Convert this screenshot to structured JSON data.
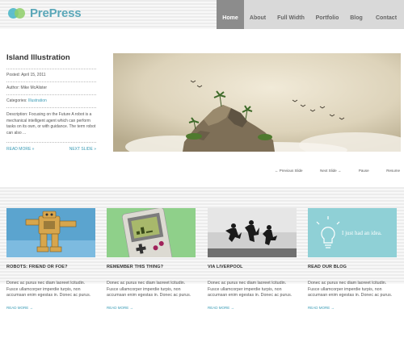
{
  "brand": {
    "name": "PrePress"
  },
  "nav": [
    {
      "label": "Home",
      "active": true
    },
    {
      "label": "About"
    },
    {
      "label": "Full Width"
    },
    {
      "label": "Portfolio"
    },
    {
      "label": "Blog"
    },
    {
      "label": "Contact"
    }
  ],
  "feature": {
    "title": "Island Illustration",
    "posted": "Posted: April 15, 2011",
    "author": "Author: Mike McAlister",
    "categories_label": "Categories:",
    "category": "Illustration",
    "description": "Description: Focusing on the Future A robot is a mechanical intelligent agent which can perform tasks on its own, or with guidance. The term robot can also ...",
    "read_more": "READ MORE »",
    "next_slide": "NEXT SLIDE »"
  },
  "slider": {
    "prev": "← Previous Slide",
    "next": "Next Slide →",
    "pause": "Pause",
    "resume": "Resume"
  },
  "cards": [
    {
      "title": "ROBOTS: FRIEND OR FOE?",
      "body": "Donec ac purus nec diam laoreet lcitudin. Fusce ullamcorper imperdie turpis, non accumsan enim egestas in. Donec ac purus.",
      "more": "READ MORE →"
    },
    {
      "title": "REMEMBER THIS THING?",
      "body": "Donec ac purus nec diam laoreet lcitudin. Fusce ullamcorper imperdie turpis, non accumsan enim egestas in. Donec ac purus.",
      "more": "READ MORE →"
    },
    {
      "title": "VIA LIVERPOOL",
      "body": "Donec ac purus nec diam laoreet lcitudin. Fusce ullamcorper imperdie turpis, non accumsan enim egestas in. Donec ac purus.",
      "more": "READ MORE →"
    },
    {
      "title": "READ OUR BLOG",
      "body": "Donec ac purus nec diam laoreet lcitudin. Fusce ullamcorper imperdie turpis, non accumsan enim egestas in. Donec ac purus.",
      "more": "READ MORE →",
      "image_text": "I just had an idea."
    }
  ],
  "colors": {
    "accent": "#3a9bb5",
    "nav_active": "#8c8c8c",
    "nav_bg": "#d9d9d9"
  }
}
